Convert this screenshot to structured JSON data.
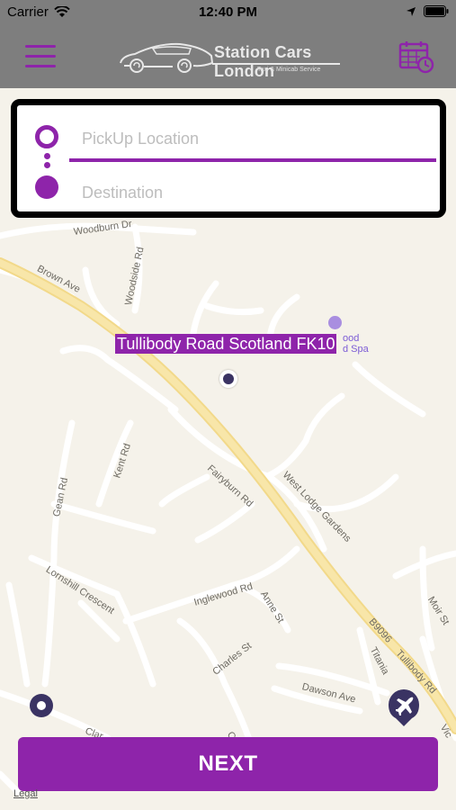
{
  "status_bar": {
    "carrier": "Carrier",
    "time": "12:40 PM"
  },
  "header": {
    "logo_title": "Station Cars London",
    "logo_subtitle": "Taxi & Minicab Service"
  },
  "location": {
    "pickup_placeholder": "PickUp Location",
    "destination_placeholder": "Destination"
  },
  "map": {
    "selected_address": "Tullibody Road Scotland FK10",
    "poi_text_line1": "ood",
    "poi_text_line2": "d Spa",
    "road_labels": {
      "woodburn": "Woodburn Dr",
      "brown": "Brown Ave",
      "woodside": "Woodside Rd",
      "kent": "Kent Rd",
      "fairyburn": "Fairyburn Rd",
      "west_lodge": "West Lodge Gardens",
      "gean": "Gean Rd",
      "lornshill": "Lornshill Crescent",
      "inglewood": "Inglewood Rd",
      "anne": "Anne St",
      "charles": "Charles St",
      "b9096": "B9096",
      "tullibody": "Tullibody Rd",
      "titania": "Titania",
      "dawson": "Dawson Ave",
      "moir": "Moir St",
      "clar": "Clar",
      "vic": "Vic",
      "ch": "Ch"
    },
    "legal": "Legal"
  },
  "actions": {
    "next_label": "NEXT"
  },
  "colors": {
    "accent": "#8e24aa",
    "header_bg": "#7e7e7e",
    "pin": "#3a3363"
  }
}
